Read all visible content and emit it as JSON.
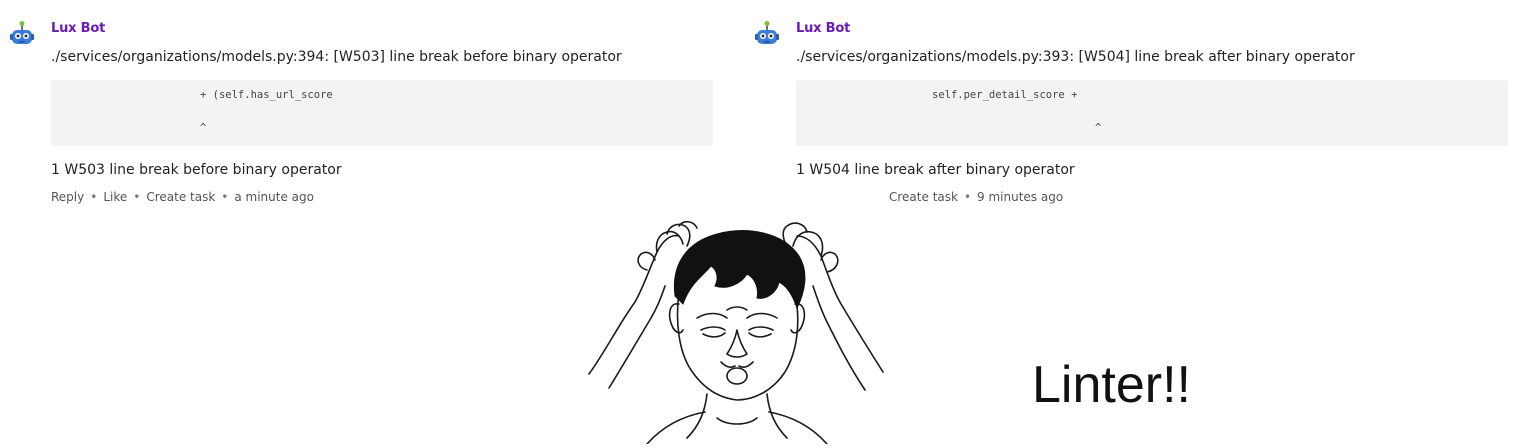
{
  "comments": [
    {
      "author": "Lux Bot",
      "message": "./services/organizations/models.py:394: [W503] line break before binary operator",
      "code_lines": [
        "+ (self.has_url_score",
        "^"
      ],
      "summary": "1 W503 line break before binary operator",
      "actions": [
        "Reply",
        "Like",
        "Create task"
      ],
      "timestamp": "a minute ago",
      "avatar_icon": "robot-icon"
    },
    {
      "author": "Lux Bot",
      "message": "./services/organizations/models.py:393: [W504] line break after binary operator",
      "code_lines": [
        "self.per_detail_score +",
        "^"
      ],
      "summary": "1 W504 line break after binary operator",
      "actions": [
        "Create task"
      ],
      "timestamp": "9 minutes ago",
      "avatar_icon": "robot-icon"
    }
  ],
  "caption": "Linter!!",
  "separator": "•",
  "colors": {
    "author": "#6a1bb5",
    "code_bg": "#f3f3f5",
    "robot": "#3b7dd8"
  }
}
